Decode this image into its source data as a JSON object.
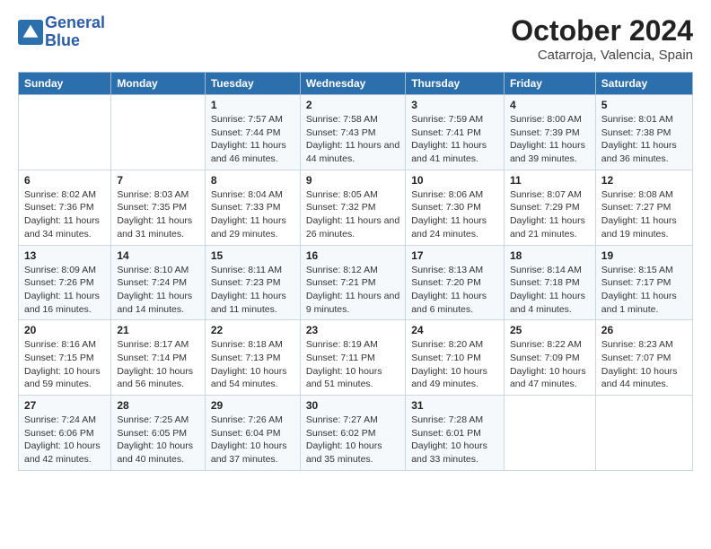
{
  "header": {
    "logo_line1": "General",
    "logo_line2": "Blue",
    "month": "October 2024",
    "location": "Catarroja, Valencia, Spain"
  },
  "days_of_week": [
    "Sunday",
    "Monday",
    "Tuesday",
    "Wednesday",
    "Thursday",
    "Friday",
    "Saturday"
  ],
  "weeks": [
    [
      {
        "num": "",
        "detail": ""
      },
      {
        "num": "",
        "detail": ""
      },
      {
        "num": "1",
        "detail": "Sunrise: 7:57 AM\nSunset: 7:44 PM\nDaylight: 11 hours and 46 minutes."
      },
      {
        "num": "2",
        "detail": "Sunrise: 7:58 AM\nSunset: 7:43 PM\nDaylight: 11 hours and 44 minutes."
      },
      {
        "num": "3",
        "detail": "Sunrise: 7:59 AM\nSunset: 7:41 PM\nDaylight: 11 hours and 41 minutes."
      },
      {
        "num": "4",
        "detail": "Sunrise: 8:00 AM\nSunset: 7:39 PM\nDaylight: 11 hours and 39 minutes."
      },
      {
        "num": "5",
        "detail": "Sunrise: 8:01 AM\nSunset: 7:38 PM\nDaylight: 11 hours and 36 minutes."
      }
    ],
    [
      {
        "num": "6",
        "detail": "Sunrise: 8:02 AM\nSunset: 7:36 PM\nDaylight: 11 hours and 34 minutes."
      },
      {
        "num": "7",
        "detail": "Sunrise: 8:03 AM\nSunset: 7:35 PM\nDaylight: 11 hours and 31 minutes."
      },
      {
        "num": "8",
        "detail": "Sunrise: 8:04 AM\nSunset: 7:33 PM\nDaylight: 11 hours and 29 minutes."
      },
      {
        "num": "9",
        "detail": "Sunrise: 8:05 AM\nSunset: 7:32 PM\nDaylight: 11 hours and 26 minutes."
      },
      {
        "num": "10",
        "detail": "Sunrise: 8:06 AM\nSunset: 7:30 PM\nDaylight: 11 hours and 24 minutes."
      },
      {
        "num": "11",
        "detail": "Sunrise: 8:07 AM\nSunset: 7:29 PM\nDaylight: 11 hours and 21 minutes."
      },
      {
        "num": "12",
        "detail": "Sunrise: 8:08 AM\nSunset: 7:27 PM\nDaylight: 11 hours and 19 minutes."
      }
    ],
    [
      {
        "num": "13",
        "detail": "Sunrise: 8:09 AM\nSunset: 7:26 PM\nDaylight: 11 hours and 16 minutes."
      },
      {
        "num": "14",
        "detail": "Sunrise: 8:10 AM\nSunset: 7:24 PM\nDaylight: 11 hours and 14 minutes."
      },
      {
        "num": "15",
        "detail": "Sunrise: 8:11 AM\nSunset: 7:23 PM\nDaylight: 11 hours and 11 minutes."
      },
      {
        "num": "16",
        "detail": "Sunrise: 8:12 AM\nSunset: 7:21 PM\nDaylight: 11 hours and 9 minutes."
      },
      {
        "num": "17",
        "detail": "Sunrise: 8:13 AM\nSunset: 7:20 PM\nDaylight: 11 hours and 6 minutes."
      },
      {
        "num": "18",
        "detail": "Sunrise: 8:14 AM\nSunset: 7:18 PM\nDaylight: 11 hours and 4 minutes."
      },
      {
        "num": "19",
        "detail": "Sunrise: 8:15 AM\nSunset: 7:17 PM\nDaylight: 11 hours and 1 minute."
      }
    ],
    [
      {
        "num": "20",
        "detail": "Sunrise: 8:16 AM\nSunset: 7:15 PM\nDaylight: 10 hours and 59 minutes."
      },
      {
        "num": "21",
        "detail": "Sunrise: 8:17 AM\nSunset: 7:14 PM\nDaylight: 10 hours and 56 minutes."
      },
      {
        "num": "22",
        "detail": "Sunrise: 8:18 AM\nSunset: 7:13 PM\nDaylight: 10 hours and 54 minutes."
      },
      {
        "num": "23",
        "detail": "Sunrise: 8:19 AM\nSunset: 7:11 PM\nDaylight: 10 hours and 51 minutes."
      },
      {
        "num": "24",
        "detail": "Sunrise: 8:20 AM\nSunset: 7:10 PM\nDaylight: 10 hours and 49 minutes."
      },
      {
        "num": "25",
        "detail": "Sunrise: 8:22 AM\nSunset: 7:09 PM\nDaylight: 10 hours and 47 minutes."
      },
      {
        "num": "26",
        "detail": "Sunrise: 8:23 AM\nSunset: 7:07 PM\nDaylight: 10 hours and 44 minutes."
      }
    ],
    [
      {
        "num": "27",
        "detail": "Sunrise: 7:24 AM\nSunset: 6:06 PM\nDaylight: 10 hours and 42 minutes."
      },
      {
        "num": "28",
        "detail": "Sunrise: 7:25 AM\nSunset: 6:05 PM\nDaylight: 10 hours and 40 minutes."
      },
      {
        "num": "29",
        "detail": "Sunrise: 7:26 AM\nSunset: 6:04 PM\nDaylight: 10 hours and 37 minutes."
      },
      {
        "num": "30",
        "detail": "Sunrise: 7:27 AM\nSunset: 6:02 PM\nDaylight: 10 hours and 35 minutes."
      },
      {
        "num": "31",
        "detail": "Sunrise: 7:28 AM\nSunset: 6:01 PM\nDaylight: 10 hours and 33 minutes."
      },
      {
        "num": "",
        "detail": ""
      },
      {
        "num": "",
        "detail": ""
      }
    ]
  ]
}
